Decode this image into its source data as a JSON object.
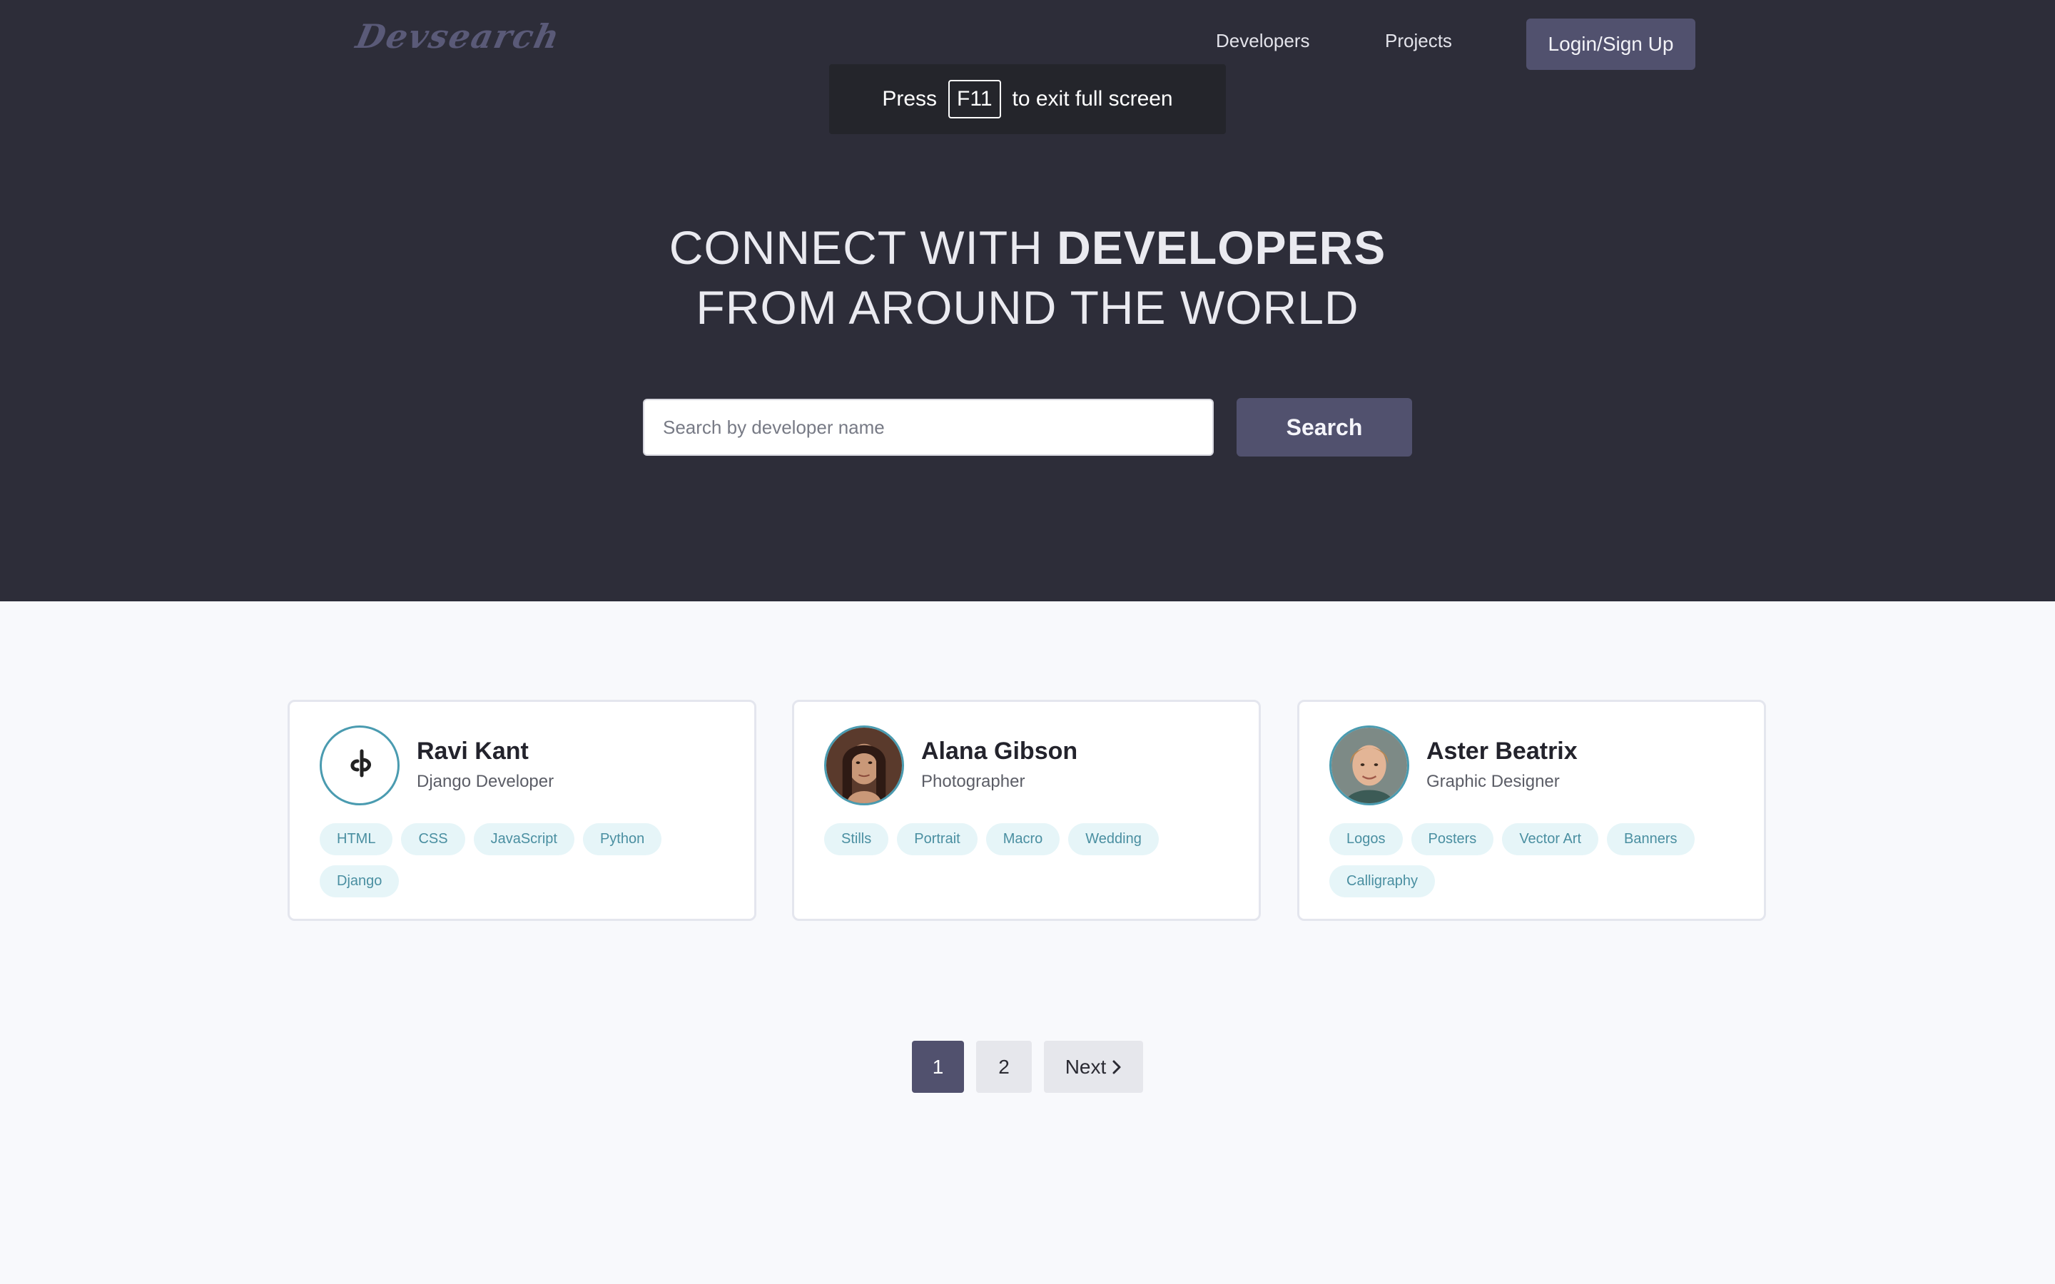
{
  "brand": {
    "logo_text": "Devsearch"
  },
  "nav": {
    "developers": "Developers",
    "projects": "Projects",
    "login": "Login/Sign Up"
  },
  "fullscreen_notice": {
    "before": "Press",
    "key": "F11",
    "after": "to exit full screen"
  },
  "hero": {
    "line1_light": "CONNECT WITH",
    "line1_bold": "DEVELOPERS",
    "line2": "FROM AROUND THE WORLD"
  },
  "search": {
    "placeholder": "Search by developer name",
    "button": "Search"
  },
  "developers": [
    {
      "name": "Ravi Kant",
      "role": "Django Developer",
      "tags": [
        "HTML",
        "CSS",
        "JavaScript",
        "Python",
        "Django"
      ]
    },
    {
      "name": "Alana Gibson",
      "role": "Photographer",
      "tags": [
        "Stills",
        "Portrait",
        "Macro",
        "Wedding"
      ]
    },
    {
      "name": "Aster Beatrix",
      "role": "Graphic Designer",
      "tags": [
        "Logos",
        "Posters",
        "Vector Art",
        "Banners",
        "Calligraphy"
      ]
    }
  ],
  "pagination": {
    "pages": [
      "1",
      "2"
    ],
    "current": "1",
    "next": "Next"
  },
  "colors": {
    "hero_bg": "#2d2d39",
    "accent": "#51516e",
    "tag_bg": "#e6f5f8",
    "tag_text": "#4a8fa1"
  }
}
